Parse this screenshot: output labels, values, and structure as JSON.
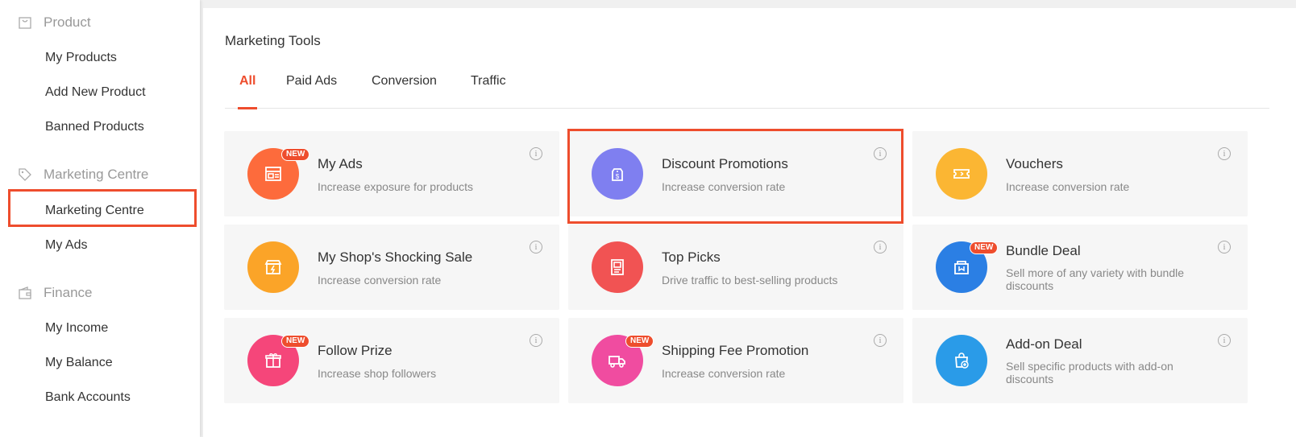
{
  "sidebar": {
    "sections": [
      {
        "label": "Product",
        "icon": "bag-icon",
        "items": [
          "My Products",
          "Add New Product",
          "Banned Products"
        ]
      },
      {
        "label": "Marketing Centre",
        "icon": "tag-icon",
        "items": [
          "Marketing Centre",
          "My Ads"
        ]
      },
      {
        "label": "Finance",
        "icon": "wallet-icon",
        "items": [
          "My Income",
          "My Balance",
          "Bank Accounts"
        ]
      }
    ],
    "active_item": "Marketing Centre"
  },
  "main": {
    "title": "Marketing Tools",
    "tabs": [
      "All",
      "Paid Ads",
      "Conversion",
      "Traffic"
    ],
    "active_tab": "All",
    "badge_text": "NEW",
    "tools": [
      {
        "title": "My Ads",
        "desc": "Increase exposure for products",
        "icon": "ads-icon",
        "color": "#fd6b3c",
        "new": true
      },
      {
        "title": "Discount Promotions",
        "desc": "Increase conversion rate",
        "icon": "price-tag-icon",
        "color": "#7f7ff0",
        "new": false,
        "highlighted": true
      },
      {
        "title": "Vouchers",
        "desc": "Increase conversion rate",
        "icon": "voucher-icon",
        "color": "#fbb633",
        "new": false
      },
      {
        "title": "My Shop's Shocking Sale",
        "desc": "Increase conversion rate",
        "icon": "shop-sale-icon",
        "color": "#fba428",
        "new": false
      },
      {
        "title": "Top Picks",
        "desc": "Drive traffic to best-selling products",
        "icon": "top-picks-icon",
        "color": "#f15353",
        "new": false
      },
      {
        "title": "Bundle Deal",
        "desc": "Sell more of any variety with bundle discounts",
        "icon": "bundle-icon",
        "color": "#2b7fe4",
        "new": true
      },
      {
        "title": "Follow Prize",
        "desc": "Increase shop followers",
        "icon": "gift-icon",
        "color": "#f5467a",
        "new": true
      },
      {
        "title": "Shipping Fee Promotion",
        "desc": "Increase conversion rate",
        "icon": "truck-icon",
        "color": "#f04ca0",
        "new": true
      },
      {
        "title": "Add-on Deal",
        "desc": "Sell specific products with add-on discounts",
        "icon": "add-on-bag-icon",
        "color": "#2a9be8",
        "new": false
      }
    ]
  }
}
